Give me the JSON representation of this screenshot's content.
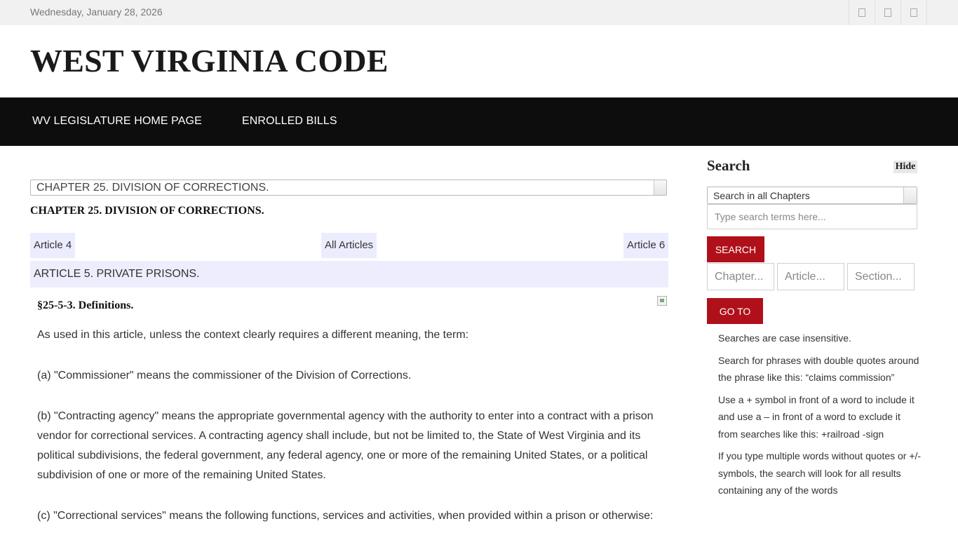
{
  "topbar": {
    "date": "Wednesday, January 28, 2026",
    "icons": [
      "icon-1",
      "icon-2",
      "icon-3"
    ]
  },
  "header": {
    "title": "WEST VIRGINIA CODE"
  },
  "nav": {
    "home": "WV LEGISLATURE HOME PAGE",
    "bills": "ENROLLED BILLS"
  },
  "main": {
    "chapter_select": "CHAPTER 25. DIVISION OF CORRECTIONS.",
    "chapter_heading": "CHAPTER 25. DIVISION OF CORRECTIONS.",
    "article_nav": {
      "prev": "Article 4",
      "all": "All Articles",
      "next": "Article 6"
    },
    "article_title": "ARTICLE 5. PRIVATE PRISONS.",
    "section_title": "§25-5-3. Definitions.",
    "paragraphs": [
      "As used in this article, unless the context clearly requires a different meaning, the term:",
      "(a) \"Commissioner\" means the commissioner of the Division of Corrections.",
      "(b) \"Contracting agency\" means the appropriate governmental agency with the authority to enter into a contract with a prison vendor for correctional services. A contracting agency shall include, but not be limited to, the State of West Virginia and its political subdivisions, the federal government, any federal agency, one or more of the remaining United States, or a political subdivision of one or more of the remaining United States.",
      "(c) \"Correctional services\" means the following functions, services and activities, when provided within a prison or otherwise:"
    ]
  },
  "sidebar": {
    "heading": "Search",
    "hide_label": "Hide",
    "scope_select": "Search in all Chapters",
    "search_placeholder": "Type search terms here...",
    "search_button": "SEARCH",
    "chapter_placeholder": "Chapter...",
    "article_placeholder": "Article...",
    "section_placeholder": "Section...",
    "goto_button": "GO TO",
    "tips": [
      "Searches are case insensitive.",
      "Search for phrases with double quotes around the phrase like this: “claims commission”",
      "Use a + symbol in front of a word to include it and use a – in front of a word to exclude it from searches like this: +railroad -sign",
      "If you type multiple words without quotes or +/- symbols, the search will look for all results containing any of the words"
    ]
  },
  "colors": {
    "accent": "#b0101a",
    "nav_bg": "#0d0d0d",
    "highlight": "#ececff"
  }
}
